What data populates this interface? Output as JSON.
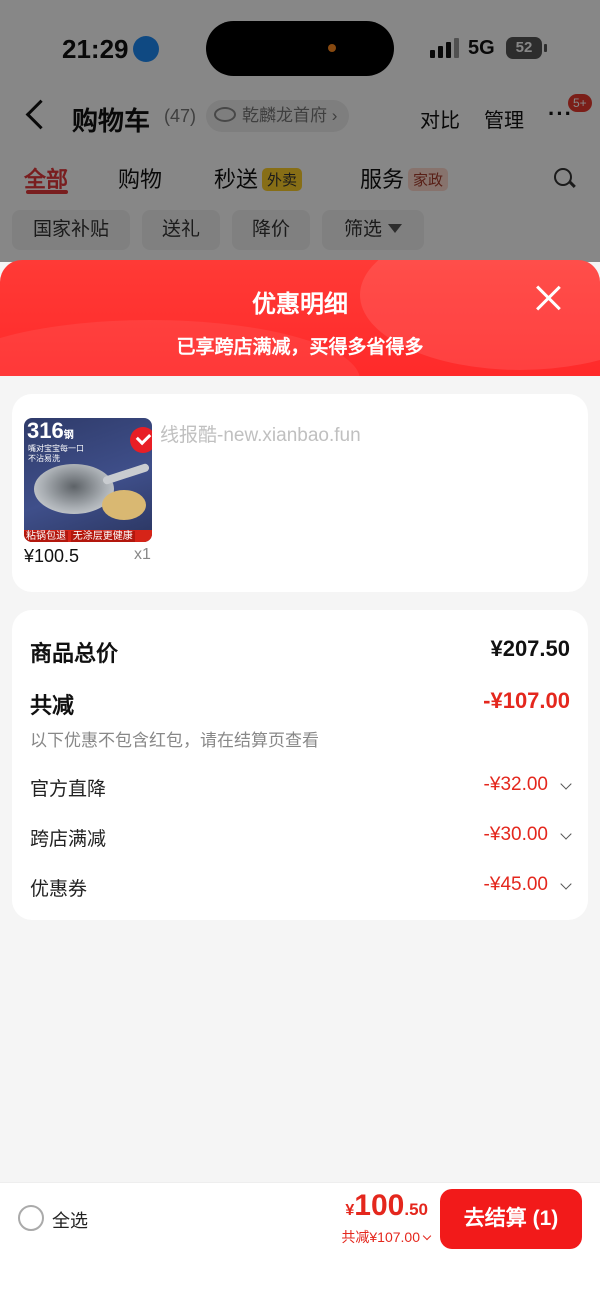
{
  "status_bar": {
    "time": "21:29",
    "network": "5G",
    "battery": "52"
  },
  "nav": {
    "title": "购物车",
    "count": "(47)",
    "store": "乾麟龙首府",
    "compare": "对比",
    "manage": "管理",
    "message_badge": "5+"
  },
  "tabs": [
    {
      "label": "全部",
      "active": true
    },
    {
      "label": "购物"
    },
    {
      "label": "秒送",
      "tag": "外卖"
    },
    {
      "label": "服务",
      "tag": "家政"
    }
  ],
  "chips": [
    "国家补贴",
    "送礼",
    "降价",
    "筛选"
  ],
  "sheet": {
    "title": "优惠明细",
    "subtitle": "已享跨店满减，买得多省得多"
  },
  "product": {
    "thumb_badge": "316",
    "thumb_badge_suffix": "钢",
    "thumb_line1": "嘴对宝宝每一口",
    "thumb_line2": "不沾易洗",
    "thumb_banner_left": "粘锅包退",
    "thumb_banner_right": "无涂层更健康",
    "watermark": "线报酷-new.xianbao.fun",
    "price": "¥100.5",
    "qty": "x1"
  },
  "summary": {
    "total_label": "商品总价",
    "total_value": "¥207.50",
    "cut_label": "共减",
    "cut_value": "-¥107.00",
    "note": "以下优惠不包含红包，请在结算页查看",
    "items": [
      {
        "label": "官方直降",
        "value": "-¥32.00"
      },
      {
        "label": "跨店满减",
        "value": "-¥30.00"
      },
      {
        "label": "优惠券",
        "value": "-¥45.00"
      }
    ]
  },
  "bottom": {
    "select_all": "全选",
    "currency": "¥",
    "price_int": "100",
    "price_dec": ".50",
    "cut_text": "共减¥107.00",
    "checkout": "去结算 (1)"
  },
  "colors": {
    "accent": "#e4271d",
    "button": "#f21a1a",
    "header": "#ff3a36"
  }
}
